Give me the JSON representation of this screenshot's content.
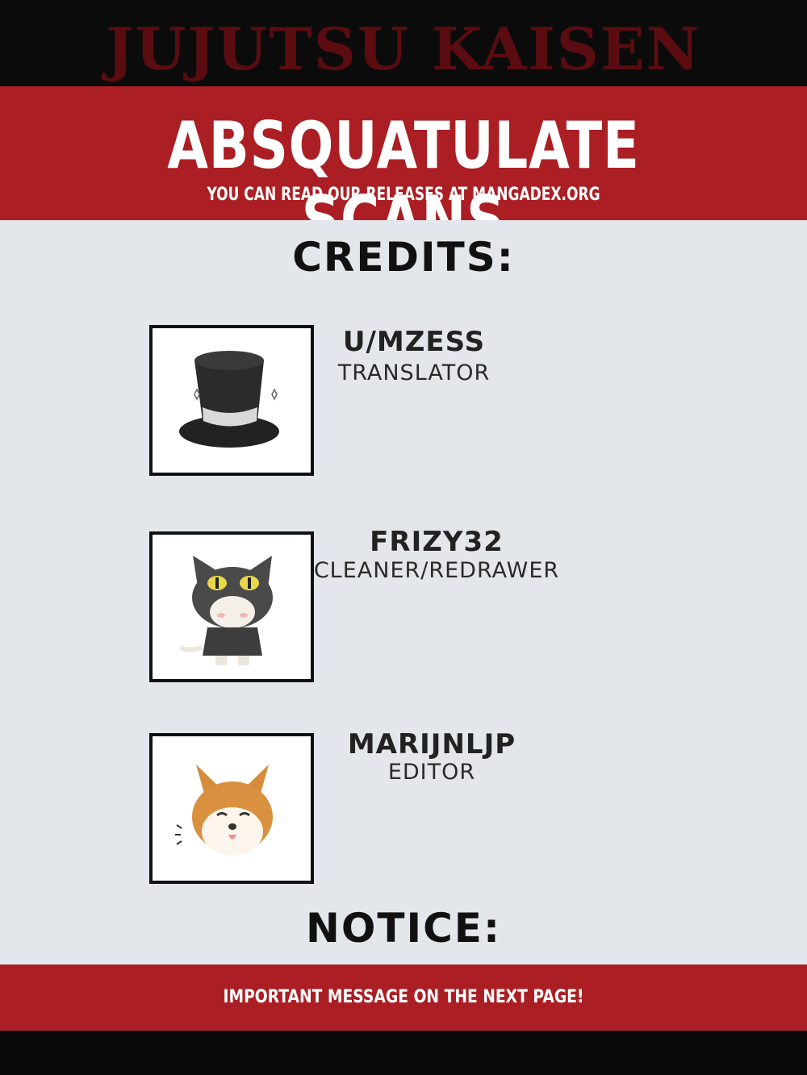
{
  "logo_text": "JUJUTSU KAISEN",
  "header": {
    "group_name": "ABSQUATULATE SCANS",
    "subtitle": "YOU CAN READ OUR RELEASES AT MANGADEX.ORG"
  },
  "credits": {
    "heading": "CREDITS:",
    "members": [
      {
        "name": "U/MZESS",
        "role": "TRANSLATOR",
        "avatar_icon": "top-hat-icon"
      },
      {
        "name": "FRIZY32",
        "role": "CLEANER/REDRAWER",
        "avatar_icon": "hooded-cat-icon"
      },
      {
        "name": "MARIJNLJP",
        "role": "EDITOR",
        "avatar_icon": "shiba-dog-icon"
      }
    ]
  },
  "notice": {
    "heading": "NOTICE:",
    "message": "IMPORTANT MESSAGE ON THE NEXT PAGE!"
  },
  "colors": {
    "brand_red": "#ab1f24",
    "panel_bg": "#e3e7eb",
    "dark": "#0b0b0b"
  }
}
